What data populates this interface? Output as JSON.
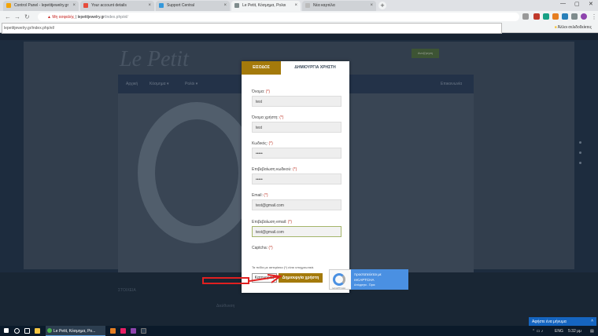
{
  "browser": {
    "tabs": [
      {
        "title": "Control Panel - lepetitjewelry.gr",
        "color": "#f4a300"
      },
      {
        "title": "Your account details",
        "color": "#e74c3c"
      },
      {
        "title": "Support Central",
        "color": "#3498db"
      },
      {
        "title": "Le Petit, Κόσμημα, Pολοι",
        "color": "#7f8c8d"
      },
      {
        "title": "Νέα καρτέλα",
        "color": "#bbb"
      }
    ],
    "omnibox": {
      "warning": "Μη ασφαλής",
      "host": "lepetitjewelry.gr",
      "path": "/index.php/el/"
    },
    "bookmarks_other": "Άλλοι σελιδοδείκτες"
  },
  "site": {
    "logo": "Le Petit",
    "search_button": "Αναζήτηση",
    "nav": [
      "Αρχική",
      "Κόσμημα ▾",
      "Ρολόι ▾"
    ],
    "nav_right": "Επικοινωνία",
    "footer": {
      "heading": "ΣΤΟΙΧΕΙΑ",
      "address_title": "Διεύθυνση"
    }
  },
  "modal": {
    "tab_login": "ΕΙΣΟΔΟΣ",
    "tab_register": "ΔΗΜΙΟΥΡΓΙΑ ΧΡΗΣΤΗ",
    "required_mark": "(*)",
    "fields": [
      {
        "label": "Όνομα:",
        "value": "test"
      },
      {
        "label": "Όνομα χρήστη:",
        "value": "test"
      },
      {
        "label": "Κωδικός:",
        "value": "•••••"
      },
      {
        "label": "Επιβεβαίωση κωδικού:",
        "value": "•••••"
      },
      {
        "label": "Email:",
        "value": "test@gmail.com"
      },
      {
        "label": "Επιβεβαίωση email:",
        "value": "test@gmail.com"
      }
    ],
    "captcha_label": "Captcha:",
    "note": "Τα πεδία με αστερίσκο (*) είναι υποχρεωτικά.",
    "login_button": "Κατηγορίες",
    "register_button": "Δημιουργία χρήστη"
  },
  "recaptcha": {
    "line1": "προστατεύεται με",
    "line2": "reCAPTCHA",
    "line3": "Απόρρητο - Όροι",
    "small": "reCAPTCHA"
  },
  "chat": {
    "label": "Αφήστε ένα μήνυμα"
  },
  "taskbar": {
    "app": "Le Petit, Κόσμημα, Ρο...",
    "lang": "ENG",
    "time": "5:32 μμ"
  }
}
